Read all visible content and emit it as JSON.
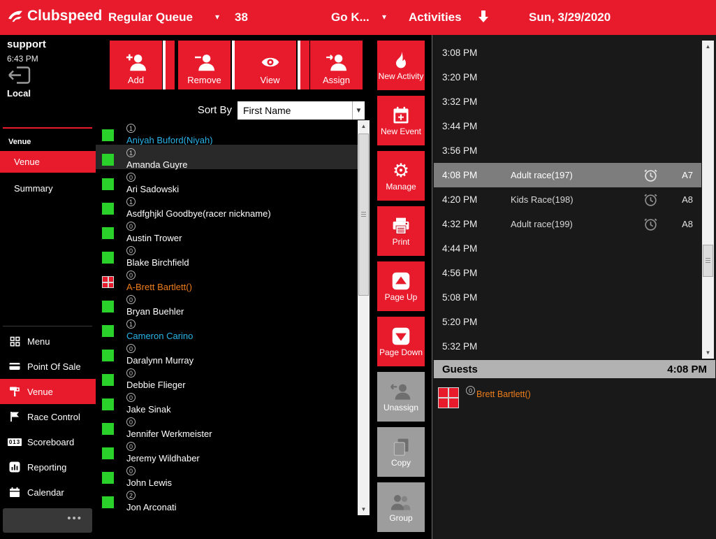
{
  "colors": {
    "accent_red": "#e81b2d",
    "status_green": "#2bd12b",
    "name_cyan": "#2ab4e8",
    "name_orange": "#ef7d1a",
    "gray_button": "#9d9d9d",
    "selected_slot_gray": "#7d7d7d"
  },
  "topbar": {
    "logo_text": "Clubspeed",
    "queue_label": "Regular Queue",
    "queue_count": "38",
    "track_label": "Go K...",
    "activities_label": "Activities",
    "date": "Sun, 3/29/2020"
  },
  "sidebar": {
    "user": "support",
    "time": "6:43 PM",
    "location": "Local",
    "venue_header": "Venue",
    "venue_items": [
      {
        "label": "Venue",
        "active": true
      },
      {
        "label": "Summary"
      }
    ],
    "nav": [
      {
        "label": "Menu"
      },
      {
        "label": "Point Of Sale"
      },
      {
        "label": "Venue",
        "active": true
      },
      {
        "label": "Race Control"
      },
      {
        "label": "Scoreboard"
      },
      {
        "label": "Reporting"
      },
      {
        "label": "Calendar"
      }
    ],
    "scoreboard_digits": "013",
    "more_label": "•••"
  },
  "toolbar": {
    "add_label": "Add",
    "remove_label": "Remove",
    "view_label": "View",
    "assign_label": "Assign",
    "sort_by_label": "Sort By",
    "sort_value": "First Name"
  },
  "racers": [
    {
      "badge": "1",
      "name": "Aniyah Buford(Niyah)",
      "color": "cyan",
      "marker": "green"
    },
    {
      "badge": "1",
      "name": "Amanda Guyre",
      "color": "white",
      "marker": "green",
      "selected": true
    },
    {
      "badge": "0",
      "name": "Ari Sadowski",
      "color": "white",
      "marker": "green"
    },
    {
      "badge": "1",
      "name": "Asdfghjkl Goodbye(racer nickname)",
      "color": "white",
      "marker": "green"
    },
    {
      "badge": "0",
      "name": "Austin Trower",
      "color": "white",
      "marker": "green"
    },
    {
      "badge": "0",
      "name": "Blake Birchfield",
      "color": "white",
      "marker": "green"
    },
    {
      "badge": "0",
      "name": "A-Brett Bartlett()",
      "color": "orange",
      "marker": "redgrid"
    },
    {
      "badge": "0",
      "name": "Bryan Buehler",
      "color": "white",
      "marker": "green"
    },
    {
      "badge": "1",
      "name": "Cameron Carino",
      "color": "cyan",
      "marker": "green"
    },
    {
      "badge": "0",
      "name": "Daralynn Murray",
      "color": "white",
      "marker": "green"
    },
    {
      "badge": "0",
      "name": "Debbie Flieger",
      "color": "white",
      "marker": "green"
    },
    {
      "badge": "0",
      "name": "Jake Sinak",
      "color": "white",
      "marker": "green"
    },
    {
      "badge": "0",
      "name": "Jennifer Werkmeister",
      "color": "white",
      "marker": "green"
    },
    {
      "badge": "0",
      "name": "Jeremy Wildhaber",
      "color": "white",
      "marker": "green"
    },
    {
      "badge": "0",
      "name": "John Lewis",
      "color": "white",
      "marker": "green"
    },
    {
      "badge": "2",
      "name": "Jon Arconati",
      "color": "white",
      "marker": "green"
    }
  ],
  "actions": [
    {
      "label": "New Activity",
      "style": "red"
    },
    {
      "label": "New Event",
      "style": "red"
    },
    {
      "label": "Manage",
      "style": "red"
    },
    {
      "label": "Print",
      "style": "red"
    },
    {
      "label": "Page Up",
      "style": "red"
    },
    {
      "label": "Page Down",
      "style": "red"
    },
    {
      "label": "Unassign",
      "style": "gray"
    },
    {
      "label": "Copy",
      "style": "gray"
    },
    {
      "label": "Group",
      "style": "gray"
    }
  ],
  "schedule": [
    {
      "time": "3:08 PM"
    },
    {
      "time": "3:20 PM"
    },
    {
      "time": "3:32 PM"
    },
    {
      "time": "3:44 PM"
    },
    {
      "time": "3:56 PM"
    },
    {
      "time": "4:08 PM",
      "race": "Adult race(197)",
      "kart": "A7",
      "selected": true
    },
    {
      "time": "4:20 PM",
      "race": "Kids Race(198)",
      "kart": "A8"
    },
    {
      "time": "4:32 PM",
      "race": "Adult race(199)",
      "kart": "A8"
    },
    {
      "time": "4:44 PM"
    },
    {
      "time": "4:56 PM"
    },
    {
      "time": "5:08 PM"
    },
    {
      "time": "5:20 PM"
    },
    {
      "time": "5:32 PM"
    }
  ],
  "guests": {
    "header": "Guests",
    "time": "4:08 PM",
    "entries": [
      {
        "badge": "0",
        "name": "Brett Bartlett()",
        "color": "orange",
        "marker": "redgrid"
      }
    ]
  }
}
